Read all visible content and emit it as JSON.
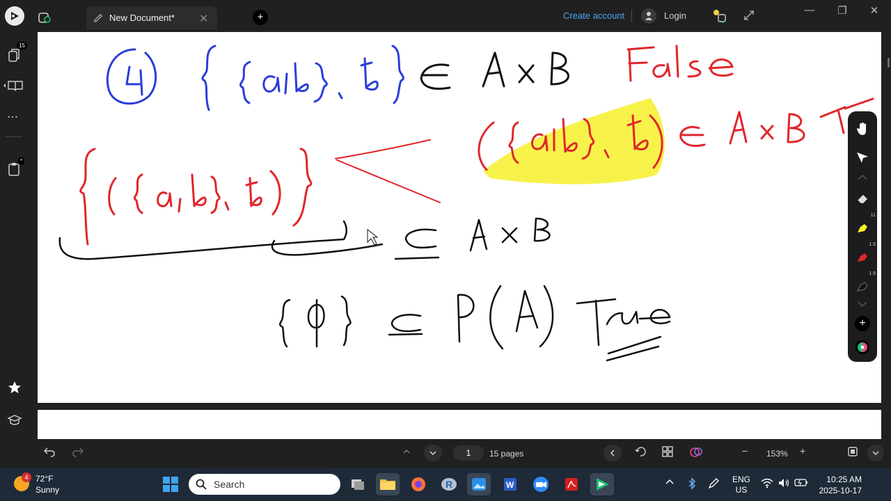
{
  "titlebar": {
    "tab_title": "New Document*",
    "new_tab_symbol": "+",
    "create_account": "Create account",
    "login": "Login",
    "window_controls": [
      "—",
      "❐",
      "✕"
    ]
  },
  "leftbar": {
    "pages_badge": "15",
    "more_symbol": "⋯",
    "notes_badge": "*"
  },
  "canvas": {
    "ink_black": "#111111",
    "ink_blue": "#2a3ed8",
    "ink_red": "#e0262b",
    "highlight": "#f6f02a",
    "strokes": {
      "line1_number": "4",
      "line1_set": "{ {a,b}, b }",
      "line1_symbol": "∈",
      "line1_product": "A × B",
      "line1_verdict": "False",
      "line2_pair": "( {a,b}, b )",
      "line2_symbol": "∈",
      "line2_product": "A × B",
      "line2_verdict": "T",
      "line3_set": "{ ( {a,b}, b ) }",
      "line3_symbol": "⊆",
      "line3_product": "A × B",
      "line4_set": "{ϕ}",
      "line4_symbol": "⊆",
      "line4_power": "P(A)",
      "line4_verdict": "True"
    }
  },
  "pen_panel": {
    "highlighter_size": "11",
    "pen_red_size": "1.5",
    "pen_black_size": "1.5",
    "add_symbol": "+"
  },
  "bottombar": {
    "current_page": "1",
    "page_count": "15 pages",
    "zoom": "153%",
    "zoom_out": "−",
    "zoom_in": "+"
  },
  "taskbar": {
    "weather_badge": "4",
    "temperature": "72°F",
    "condition": "Sunny",
    "search_label": "Search",
    "lang_top": "ENG",
    "lang_bottom": "US",
    "time": "10:25 AM",
    "date": "2025-10-17"
  }
}
